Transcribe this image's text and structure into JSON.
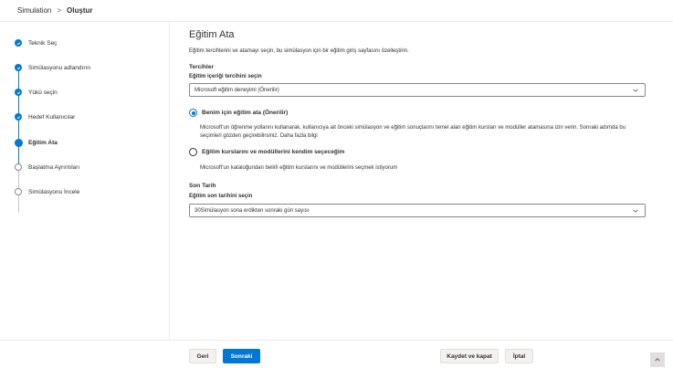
{
  "breadcrumb": {
    "root": "Simulation",
    "separator": ">",
    "current": "Oluştur"
  },
  "steps": [
    {
      "label": "Teknik Seç",
      "state": "done"
    },
    {
      "label": "Simülasyonu adlandırın",
      "state": "done"
    },
    {
      "label": "Yükü seçin",
      "state": "done"
    },
    {
      "label": "Hedef Kullanıcılar",
      "state": "done"
    },
    {
      "label": "Eğitim Ata",
      "state": "current"
    },
    {
      "label": "Başlatma Ayrıntıları",
      "state": "todo"
    },
    {
      "label": "Simülasyonu İncele",
      "state": "todo"
    }
  ],
  "main": {
    "title": "Eğitim Ata",
    "description": "Eğitim tercihlerini ve atamayı seçin, bu simülasyon için bir eğitim giriş sayfasını özelleştirin.",
    "preferences": {
      "section_label": "Tercihler",
      "field_label": "Eğitim içeriği tercihini seçin",
      "selected_value": "Microsoft eğitim deneyimi (Önerilir)"
    },
    "options": [
      {
        "label": "Benim için eğitim ata (Önerilir)",
        "selected": true,
        "description": "Microsoft'un öğrenme yollarını kullanarak, kullanıcıya ait önceki simülasyon ve eğitim sonuçlarını temel alan eğitim kursları ve modüller atamasına izin verin. Sonraki adımda bu seçimleri gözden geçirebilirsiniz. Daha fazla bilgi"
      },
      {
        "label": "Eğitim kurslarını ve modüllerini kendim seçeceğim",
        "selected": false,
        "description": "Microsoft'un kataloğundan belirli eğitim kurslarını ve modüllerini seçmek istiyorum"
      }
    ],
    "due_date": {
      "section_label": "Son Tarih",
      "field_label": "Eğitim son tarihini seçin",
      "selected_value": "30Simülasyon sona erdikten sonraki gün sayısı"
    }
  },
  "footer": {
    "back_label": "Geri",
    "next_label": "Sonraki",
    "save_close_label": "Kaydet ve kapat",
    "cancel_label": "İptal"
  },
  "colors": {
    "accent": "#0078d4",
    "border": "#8a8886",
    "text": "#323130"
  },
  "icons": {
    "check": "checkmark-icon",
    "chevron": "chevron-down-icon",
    "scroll_top": "chevron-up-icon"
  }
}
